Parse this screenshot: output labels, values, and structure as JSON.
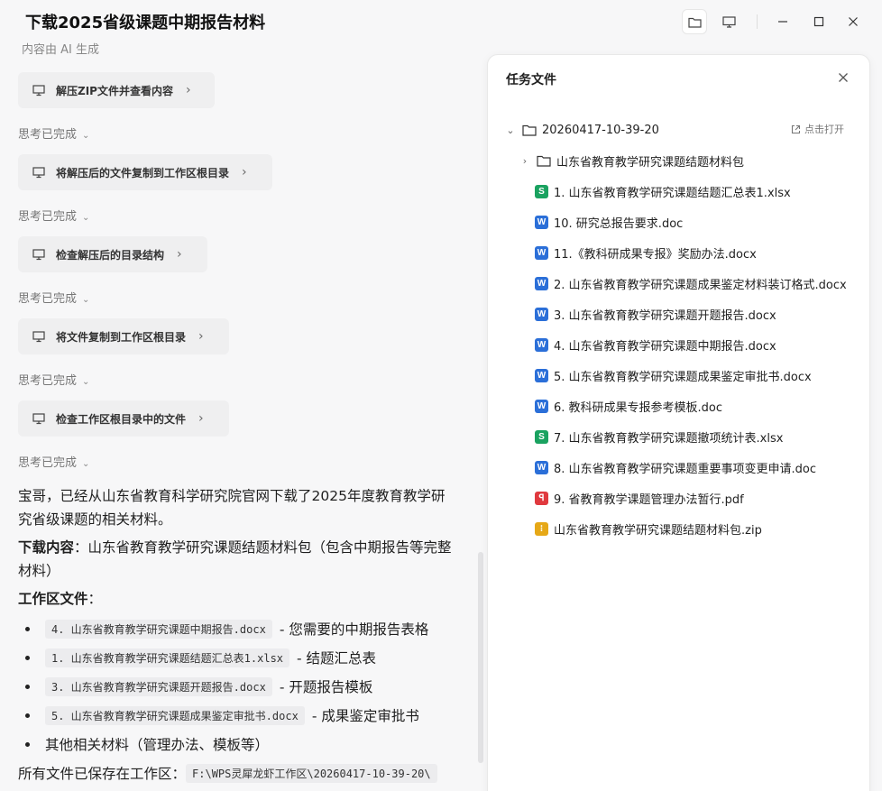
{
  "window": {
    "title": "下载2025省级课题中期报告材料",
    "subtitle": "内容由 AI 生成"
  },
  "chat": {
    "steps": [
      {
        "label": "解压ZIP文件并查看内容"
      },
      {
        "label": "将解压后的文件复制到工作区根目录"
      },
      {
        "label": "检查解压后的目录结构"
      },
      {
        "label": "将文件复制到工作区根目录"
      },
      {
        "label": "检查工作区根目录中的文件"
      }
    ],
    "thinking_label": "思考已完成",
    "intro_line1": "宝哥，已经从山东省教育科学研究院官网下载了2025年度教育教学研",
    "intro_line2": "究省级课题的相关材料。",
    "download_label": "下载内容",
    "download_line1": "：山东省教育教学研究课题结题材料包（包含中期报告等完整",
    "download_line2": "材料）",
    "workspace_label": "工作区文件",
    "workspace_colon": "：",
    "bullets": [
      {
        "code": "4. 山东省教育教学研究课题中期报告.docx",
        "desc": "- 您需要的中期报告表格"
      },
      {
        "code": "1. 山东省教育教学研究课题结题汇总表1.xlsx",
        "desc": "- 结题汇总表"
      },
      {
        "code": "3. 山东省教育教学研究课题开题报告.docx",
        "desc": "- 开题报告模板"
      },
      {
        "code": "5. 山东省教育教学研究课题成果鉴定审批书.docx",
        "desc": "- 成果鉴定审批书"
      },
      {
        "code": "",
        "desc": "其他相关材料（管理办法、模板等）"
      }
    ],
    "saved_text": "所有文件已保存在工作区：",
    "saved_path": "F:\\WPS灵犀龙虾工作区\\20260417-10-39-20\\"
  },
  "panel": {
    "title": "任务文件",
    "root_folder": "20260417-10-39-20",
    "open_label": "点击打开",
    "sub_folder": "山东省教育教学研究课题结题材料包",
    "files": [
      {
        "type": "S",
        "color": "#1aa260",
        "name": "1. 山东省教育教学研究课题结题汇总表1.xlsx"
      },
      {
        "type": "W",
        "color": "#2b6fd8",
        "name": "10. 研究总报告要求.doc"
      },
      {
        "type": "W",
        "color": "#2b6fd8",
        "name": "11.《教科研成果专报》奖励办法.docx"
      },
      {
        "type": "W",
        "color": "#2b6fd8",
        "name": "2. 山东省教育教学研究课题成果鉴定材料装订格式.docx"
      },
      {
        "type": "W",
        "color": "#2b6fd8",
        "name": "3. 山东省教育教学研究课题开题报告.docx"
      },
      {
        "type": "W",
        "color": "#2b6fd8",
        "name": "4. 山东省教育教学研究课题中期报告.docx"
      },
      {
        "type": "W",
        "color": "#2b6fd8",
        "name": "5. 山东省教育教学研究课题成果鉴定审批书.docx"
      },
      {
        "type": "W",
        "color": "#2b6fd8",
        "name": "6. 教科研成果专报参考模板.doc"
      },
      {
        "type": "S",
        "color": "#1aa260",
        "name": "7. 山东省教育教学研究课题撤项统计表.xlsx"
      },
      {
        "type": "W",
        "color": "#2b6fd8",
        "name": "8. 山东省教育教学研究课题重要事项变更申请.doc"
      },
      {
        "type": "P",
        "color": "#e0393e",
        "name": "9. 省教育教学课题管理办法暂行.pdf"
      },
      {
        "type": "Z",
        "color": "#e6a817",
        "name": "山东省教育教学研究课题结题材料包.zip"
      }
    ]
  }
}
